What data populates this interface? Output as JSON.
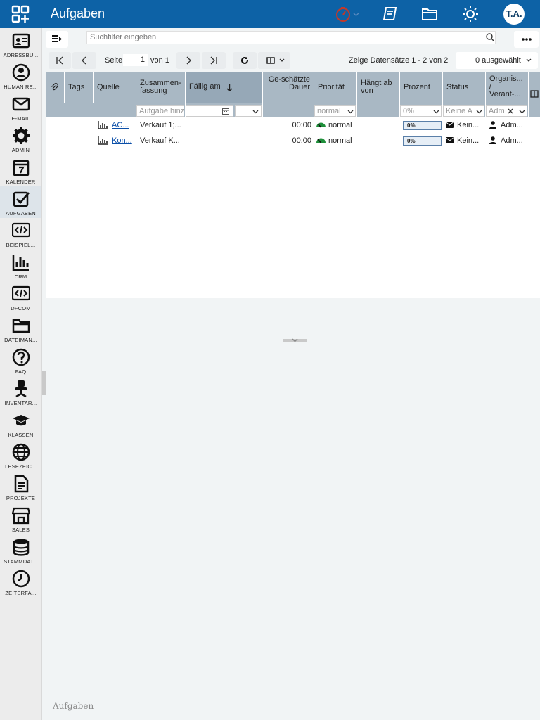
{
  "app": {
    "title": "Aufgaben",
    "user_initials": "T.A."
  },
  "topbar_icons": [
    "apps-grid-icon",
    "timer-icon",
    "book-icon",
    "folder-icon",
    "sun-icon"
  ],
  "sidebar": {
    "items": [
      {
        "label": "ADRESSBU...",
        "icon": "addressbook-icon"
      },
      {
        "label": "HUMAN RE...",
        "icon": "person-icon"
      },
      {
        "label": "E-MAIL",
        "icon": "envelope-icon"
      },
      {
        "label": "ADMIN",
        "icon": "gear-icon"
      },
      {
        "label": "KALENDER",
        "icon": "calendar-icon"
      },
      {
        "label": "AUFGABEN",
        "icon": "checkbox-icon",
        "active": true
      },
      {
        "label": "BEISPIEL...",
        "icon": "code-icon"
      },
      {
        "label": "CRM",
        "icon": "barchart-icon"
      },
      {
        "label": "DFCOM",
        "icon": "code-icon"
      },
      {
        "label": "DATEIMAN...",
        "icon": "folder-icon"
      },
      {
        "label": "FAQ",
        "icon": "question-icon"
      },
      {
        "label": "INVENTAR...",
        "icon": "chair-icon"
      },
      {
        "label": "KLASSEN",
        "icon": "graduation-cap-icon"
      },
      {
        "label": "LESEZEIC...",
        "icon": "globe-icon"
      },
      {
        "label": "PROJEKTE",
        "icon": "document-icon"
      },
      {
        "label": "SALES",
        "icon": "store-icon"
      },
      {
        "label": "STAMMDAT...",
        "icon": "database-icon"
      },
      {
        "label": "ZEITERFA...",
        "icon": "clock-icon"
      }
    ]
  },
  "filter": {
    "placeholder": "Suchfilter eingeben"
  },
  "pager": {
    "page_label": "Seite",
    "page_value": "1",
    "of_label": "von 1",
    "records": "Zeige Datensätze 1 - 2 von 2",
    "selected": "0 ausgewählt"
  },
  "grid": {
    "headers": {
      "tags": "Tags",
      "source": "Quelle",
      "summary": "Zusammen-fassung",
      "due": "Fällig am",
      "duration": "Ge-schätzte Dauer",
      "priority": "Priorität",
      "depends": "Hängt ab von",
      "percent": "Prozent",
      "status": "Status",
      "organizer": "Organis... / Verant-..."
    },
    "filters": {
      "summary": "Aufgabe hinz",
      "priority": "normal",
      "percent": "0%",
      "status": "Keine A",
      "organizer": "Adm"
    },
    "rows": [
      {
        "source": "AC...",
        "summary": "Verkauf 1;...",
        "duration": "00:00",
        "priority": "normal",
        "percent": "0%",
        "status": "Kein...",
        "organizer": "Adm..."
      },
      {
        "source": "Kon...",
        "summary": "Verkauf K...",
        "duration": "00:00",
        "priority": "normal",
        "percent": "0%",
        "status": "Kein...",
        "organizer": "Adm..."
      }
    ]
  },
  "footer": "Aufgaben"
}
